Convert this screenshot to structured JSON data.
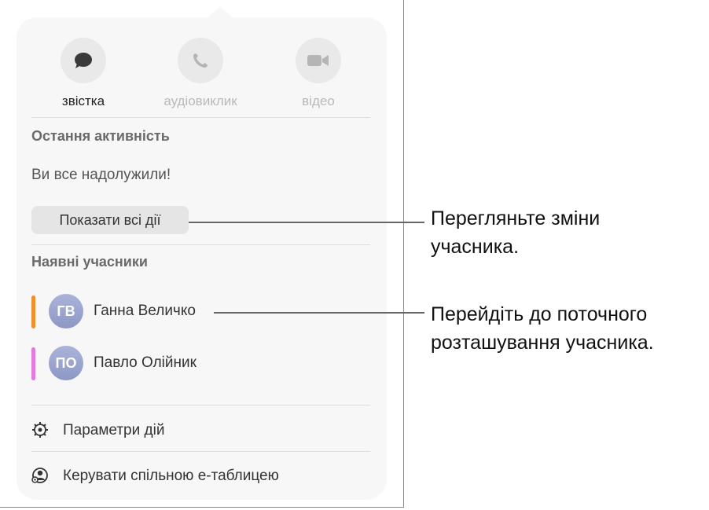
{
  "communication": [
    {
      "label": "звістка",
      "icon": "message-icon",
      "enabled": true
    },
    {
      "label": "аудіовиклик",
      "icon": "phone-icon",
      "enabled": false
    },
    {
      "label": "відео",
      "icon": "video-icon",
      "enabled": false
    }
  ],
  "recent_activity": {
    "heading": "Остання активність",
    "status": "Ви все надолужили!",
    "show_all_label": "Показати всі дії"
  },
  "participants": {
    "heading": "Наявні учасники",
    "items": [
      {
        "initials": "ГВ",
        "name": "Ганна Величко",
        "color": "#f0902a"
      },
      {
        "initials": "ПО",
        "name": "Павло Олійник",
        "color": "#e47ae0"
      }
    ]
  },
  "menu": {
    "activity_settings": "Параметри дій",
    "manage_shared": "Керувати спільною е-таблицею"
  },
  "callouts": {
    "show_changes": "Перегляньте зміни учасника.",
    "go_to_location": "Перейдіть до поточного розташування учасника."
  }
}
